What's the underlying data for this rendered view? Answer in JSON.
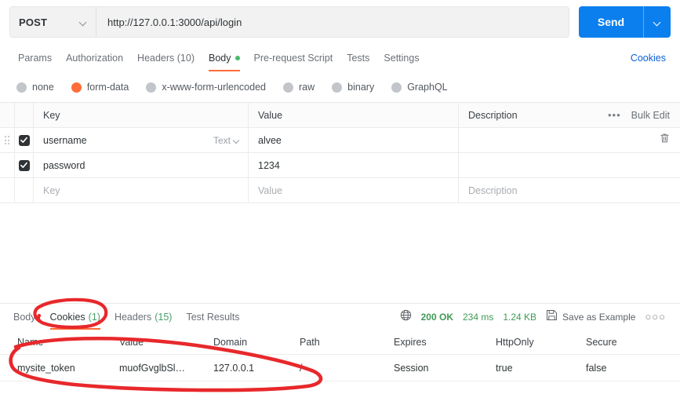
{
  "request": {
    "method": "POST",
    "url": "http://127.0.0.1:3000/api/login",
    "send_label": "Send",
    "tabs": [
      {
        "label": "Params",
        "active": false,
        "dot": false
      },
      {
        "label": "Authorization",
        "active": false,
        "dot": false
      },
      {
        "label": "Headers (10)",
        "active": false,
        "dot": false
      },
      {
        "label": "Body",
        "active": true,
        "dot": true
      },
      {
        "label": "Pre-request Script",
        "active": false,
        "dot": false
      },
      {
        "label": "Tests",
        "active": false,
        "dot": false
      },
      {
        "label": "Settings",
        "active": false,
        "dot": false
      }
    ],
    "cookies_link": "Cookies",
    "body_types": [
      {
        "label": "none",
        "selected": false
      },
      {
        "label": "form-data",
        "selected": true
      },
      {
        "label": "x-www-form-urlencoded",
        "selected": false
      },
      {
        "label": "raw",
        "selected": false
      },
      {
        "label": "binary",
        "selected": false
      },
      {
        "label": "GraphQL",
        "selected": false
      }
    ],
    "table": {
      "headers": {
        "key": "Key",
        "value": "Value",
        "description": "Description"
      },
      "bulk_edit": "Bulk Edit",
      "more": "•••",
      "rows": [
        {
          "checked": true,
          "key": "username",
          "type": "Text",
          "value": "alvee",
          "description": ""
        },
        {
          "checked": true,
          "key": "password",
          "type": "",
          "value": "1234",
          "description": ""
        }
      ],
      "placeholder_row": {
        "key": "Key",
        "value": "Value",
        "description": "Description"
      }
    }
  },
  "response": {
    "tabs": [
      {
        "label": "Body",
        "count": "",
        "active": false
      },
      {
        "label": "Cookies",
        "count": "(1)",
        "active": true
      },
      {
        "label": "Headers",
        "count": "(15)",
        "active": false
      },
      {
        "label": "Test Results",
        "count": "",
        "active": false
      }
    ],
    "status": "200 OK",
    "time": "234 ms",
    "size": "1.24 KB",
    "save_as_example": "Save as Example",
    "more": "○○○",
    "cookies_table": {
      "headers": [
        "Name",
        "Value",
        "Domain",
        "Path",
        "Expires",
        "HttpOnly",
        "Secure"
      ],
      "rows": [
        {
          "name": "mysite_token",
          "value": "muofGvglbSl…",
          "domain": "127.0.0.1",
          "path": "/",
          "expires": "Session",
          "httponly": "true",
          "secure": "false"
        }
      ]
    }
  },
  "colors": {
    "accent_orange": "#ff6c37",
    "send_blue": "#0b7fee",
    "link_blue": "#0b60d8",
    "status_green": "#3f9a56",
    "annotation_red": "#e8282b"
  }
}
